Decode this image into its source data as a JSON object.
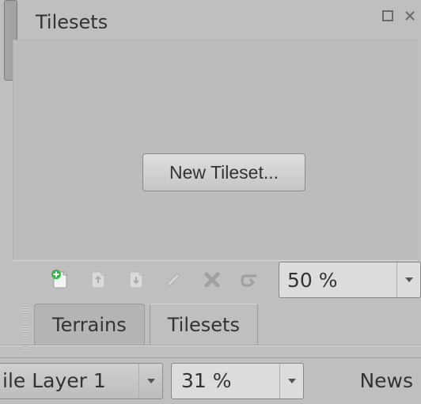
{
  "panel": {
    "title": "Tilesets"
  },
  "main": {
    "new_tileset_label": "New Tileset..."
  },
  "toolbar": {
    "new_tileset_icon": "new-doc",
    "import_icon": "import-doc",
    "export_icon": "export-doc",
    "edit_icon": "pencil",
    "delete_icon": "cross",
    "embed_icon": "embed-arrow",
    "zoom_value": "50 %"
  },
  "tabs": [
    {
      "label": "Terrains",
      "active": false
    },
    {
      "label": "Tilesets",
      "active": true
    }
  ],
  "bottom": {
    "layer_selected": "ile Layer 1",
    "opacity_value": "31 %",
    "news_label": "News"
  }
}
